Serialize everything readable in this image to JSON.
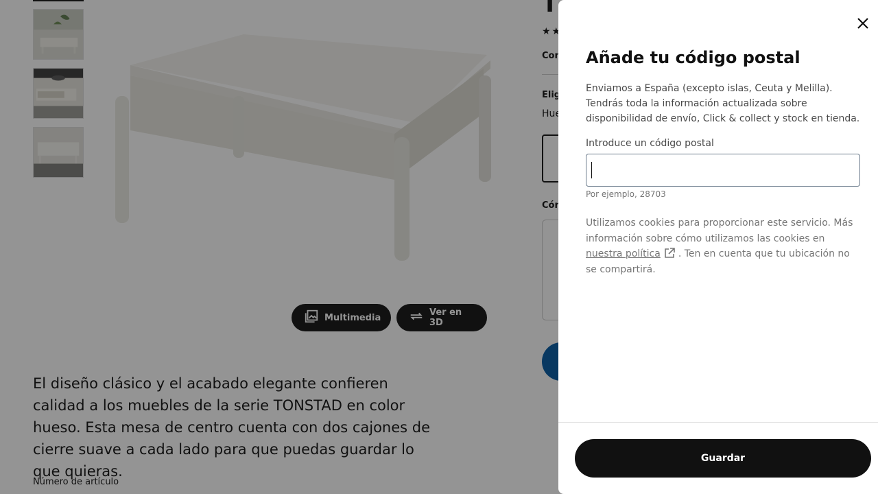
{
  "background_page": {
    "product_title_fragment": "T",
    "stars": "★★",
    "compare_fragment": "Con",
    "choose_fragment": "Elig",
    "color_fragment": "Hue",
    "how_fragment": "Cón",
    "media_buttons": {
      "multimedia": "Multimedia",
      "view_3d": "Ver en 3D"
    },
    "description": "El diseño clásico y el acabado elegante confieren calidad a los muebles de la serie TONSTAD en color hueso. Esta mesa de centro cuenta con dos cajones de cierre suave a cada lado para que puedas guardar lo que quieras.",
    "article_number_label": "Número de artículo"
  },
  "modal": {
    "title": "Añade tu código postal",
    "intro": "Enviamos a España (excepto islas, Ceuta y Melilla). Tendrás toda la información actualizada sobre disponibilidad de envío, Click & collect y stock en tienda.",
    "input": {
      "label": "Introduce un código postal",
      "value": "",
      "help": "Por ejemplo, 28703"
    },
    "cookies": {
      "text_before": "Utilizamos cookies para proporcionar este servicio. Más información sobre cómo utilizamos las cookies en",
      "link": "nuestra política",
      "text_after": ". Ten en cuenta que tu ubicación no se compartirá."
    },
    "save_label": "Guardar"
  },
  "colors": {
    "overlay": "#111111",
    "primary_button": "#111111",
    "brand_blue": "#0058a3"
  },
  "icons": {
    "close": "close-icon",
    "multimedia": "gallery-icon",
    "view_3d": "rotate-3d-icon",
    "external_link": "external-link-icon"
  }
}
